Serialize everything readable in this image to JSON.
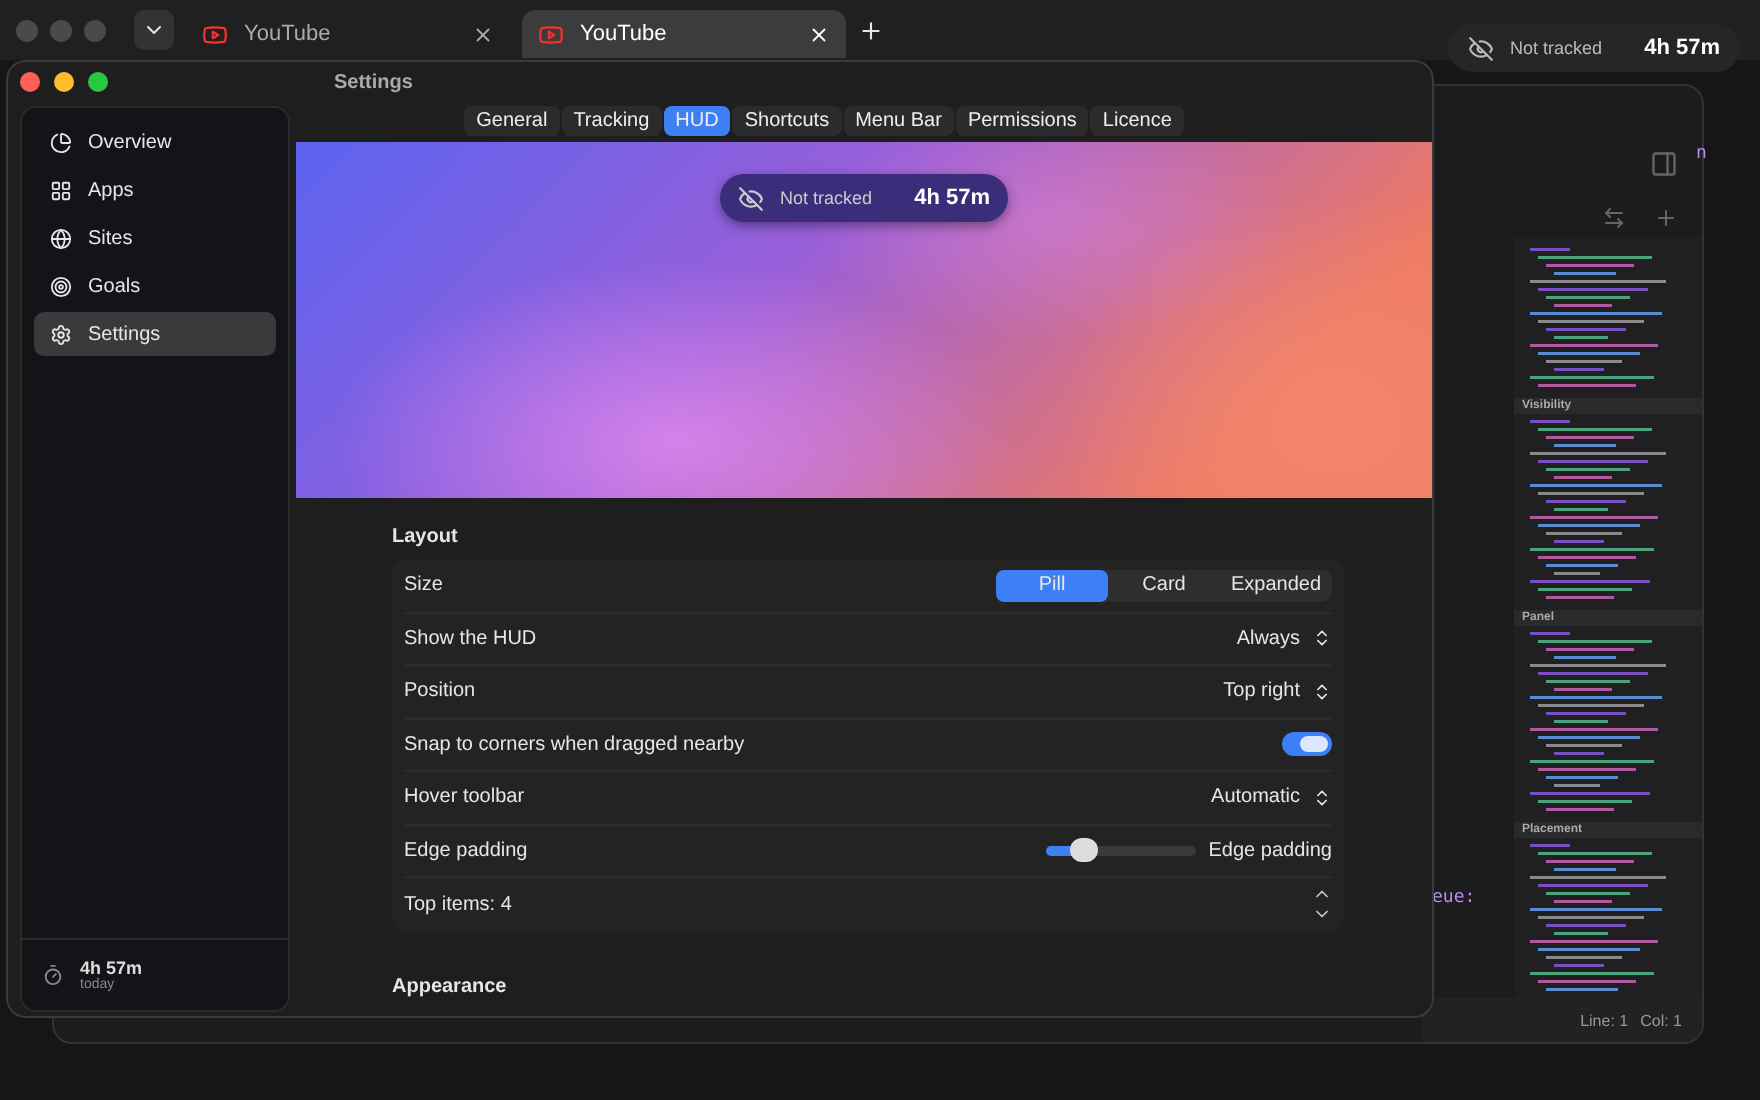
{
  "browser": {
    "tabs": [
      {
        "title": "YouTube",
        "selected": false
      },
      {
        "title": "YouTube",
        "selected": true
      }
    ]
  },
  "floating_hud": {
    "status": "Not tracked",
    "time": "4h 57m"
  },
  "editor": {
    "code_fragments": [
      "n",
      "eue:"
    ],
    "minimap_sections": [
      "Visibility",
      "Panel",
      "Placement"
    ],
    "status": [
      "Line: 1",
      "Col: 1"
    ]
  },
  "settings": {
    "title": "Settings",
    "sidebar": {
      "items": [
        {
          "label": "Overview",
          "selected": false
        },
        {
          "label": "Apps",
          "selected": false
        },
        {
          "label": "Sites",
          "selected": false
        },
        {
          "label": "Goals",
          "selected": false
        },
        {
          "label": "Settings",
          "selected": true
        }
      ],
      "footer": {
        "time": "4h 57m",
        "caption": "today"
      }
    },
    "tabs": [
      {
        "label": "General",
        "selected": false
      },
      {
        "label": "Tracking",
        "selected": false
      },
      {
        "label": "HUD",
        "selected": true
      },
      {
        "label": "Shortcuts",
        "selected": false
      },
      {
        "label": "Menu Bar",
        "selected": false
      },
      {
        "label": "Permissions",
        "selected": false
      },
      {
        "label": "Licence",
        "selected": false
      }
    ],
    "preview": {
      "status": "Not tracked",
      "time": "4h 57m"
    },
    "sections": [
      {
        "title": "Layout",
        "rows": [
          {
            "kind": "segmented",
            "label": "Size",
            "options": [
              {
                "label": "Pill",
                "selected": true
              },
              {
                "label": "Card",
                "selected": false
              },
              {
                "label": "Expanded",
                "selected": false
              }
            ]
          },
          {
            "kind": "select",
            "label": "Show the HUD",
            "value": "Always"
          },
          {
            "kind": "select",
            "label": "Position",
            "value": "Top right"
          },
          {
            "kind": "toggle",
            "label": "Snap to corners when dragged nearby",
            "on": true
          },
          {
            "kind": "select",
            "label": "Hover toolbar",
            "value": "Automatic"
          },
          {
            "kind": "slider",
            "label": "Edge padding",
            "level": 0.25,
            "reading": "Edge padding"
          },
          {
            "kind": "stepper",
            "label": "Top items: 4"
          }
        ]
      },
      {
        "title": "Appearance"
      }
    ]
  }
}
